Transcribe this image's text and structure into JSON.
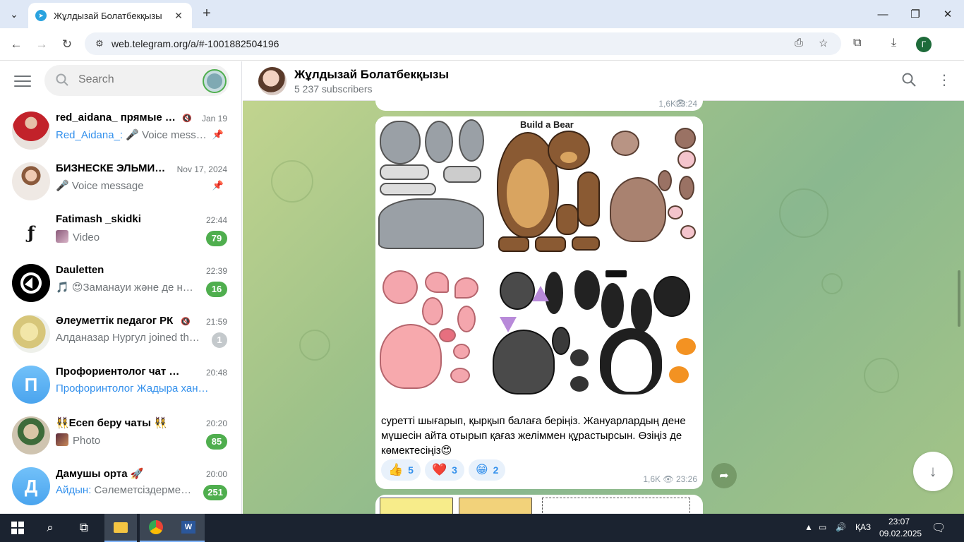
{
  "browser": {
    "tab_title": "Жұлдызай Болатбекқызы",
    "url": "web.telegram.org/a/#-1001882504196",
    "profile_initial": "Г"
  },
  "sidebar": {
    "search_placeholder": "Search",
    "chats": [
      {
        "name": "red_aidana_ прямые …",
        "time": "Jan 19",
        "sender": "Red_Aidana_:",
        "message": " 🎤 Voice mess…",
        "muted": true,
        "pinned": true,
        "badge": ""
      },
      {
        "name": "БИЗНЕСКЕ ЭЛЬМИ…",
        "time": "Nov 17, 2024",
        "sender": "",
        "message": "🎤 Voice message",
        "muted": false,
        "pinned": true,
        "badge": ""
      },
      {
        "name": "Fatimash _skidki",
        "time": "22:44",
        "sender": "",
        "message": "Video",
        "muted": false,
        "pinned": false,
        "badge": "79"
      },
      {
        "name": "Dauletten",
        "time": "22:39",
        "sender": "",
        "message": "🎵 😍Заманауи және де н…",
        "muted": false,
        "pinned": false,
        "badge": "16"
      },
      {
        "name": "Әлеуметтік педагог РК",
        "time": "21:59",
        "sender": "",
        "message": "Алданазар Нургул joined th…",
        "muted": true,
        "pinned": false,
        "badge": "1"
      },
      {
        "name": "Профориентолог чат “Фо…",
        "time": "20:48",
        "sender": "Профоринтолог Жадыра хан…",
        "message": "",
        "muted": false,
        "pinned": false,
        "badge": ""
      },
      {
        "name": "👯‍♀️Есеп беру чаты 👯‍♀️",
        "time": "20:20",
        "sender": "",
        "message": "Photo",
        "muted": false,
        "pinned": false,
        "badge": "85"
      },
      {
        "name": "Дамушы орта 🚀",
        "time": "20:00",
        "sender": "Айдын:",
        "message": " Сәлеметсіздерме…",
        "muted": false,
        "pinned": false,
        "badge": "251"
      }
    ],
    "avatar_letters": [
      "",
      "",
      "",
      "",
      "",
      "П",
      "",
      "Д"
    ]
  },
  "channel": {
    "title": "Жұлдызай Болатбекқызы",
    "subscribers": "5 237 subscribers"
  },
  "previous_post": {
    "views": "1,6K",
    "time": "23:24"
  },
  "post": {
    "image_title": "Build a Bear",
    "text": "суретті шығарып, қырқып балаға беріңіз. Жануарлардың дене мүшесін айта отырып қағаз желіммен құрастырсын. Өзіңіз де көмектесіңіз😍",
    "reactions": [
      {
        "emoji": "👍",
        "count": "5"
      },
      {
        "emoji": "❤️",
        "count": "3"
      },
      {
        "emoji": "😁",
        "count": "2"
      }
    ],
    "views": "1,6K",
    "time": "23:26"
  },
  "taskbar": {
    "language": "ҚАЗ",
    "time": "23:07",
    "date": "09.02.2025"
  },
  "colors": {
    "accent": "#3390ec",
    "badge_green": "#4fae4e",
    "chat_bg": "#9fc289"
  }
}
